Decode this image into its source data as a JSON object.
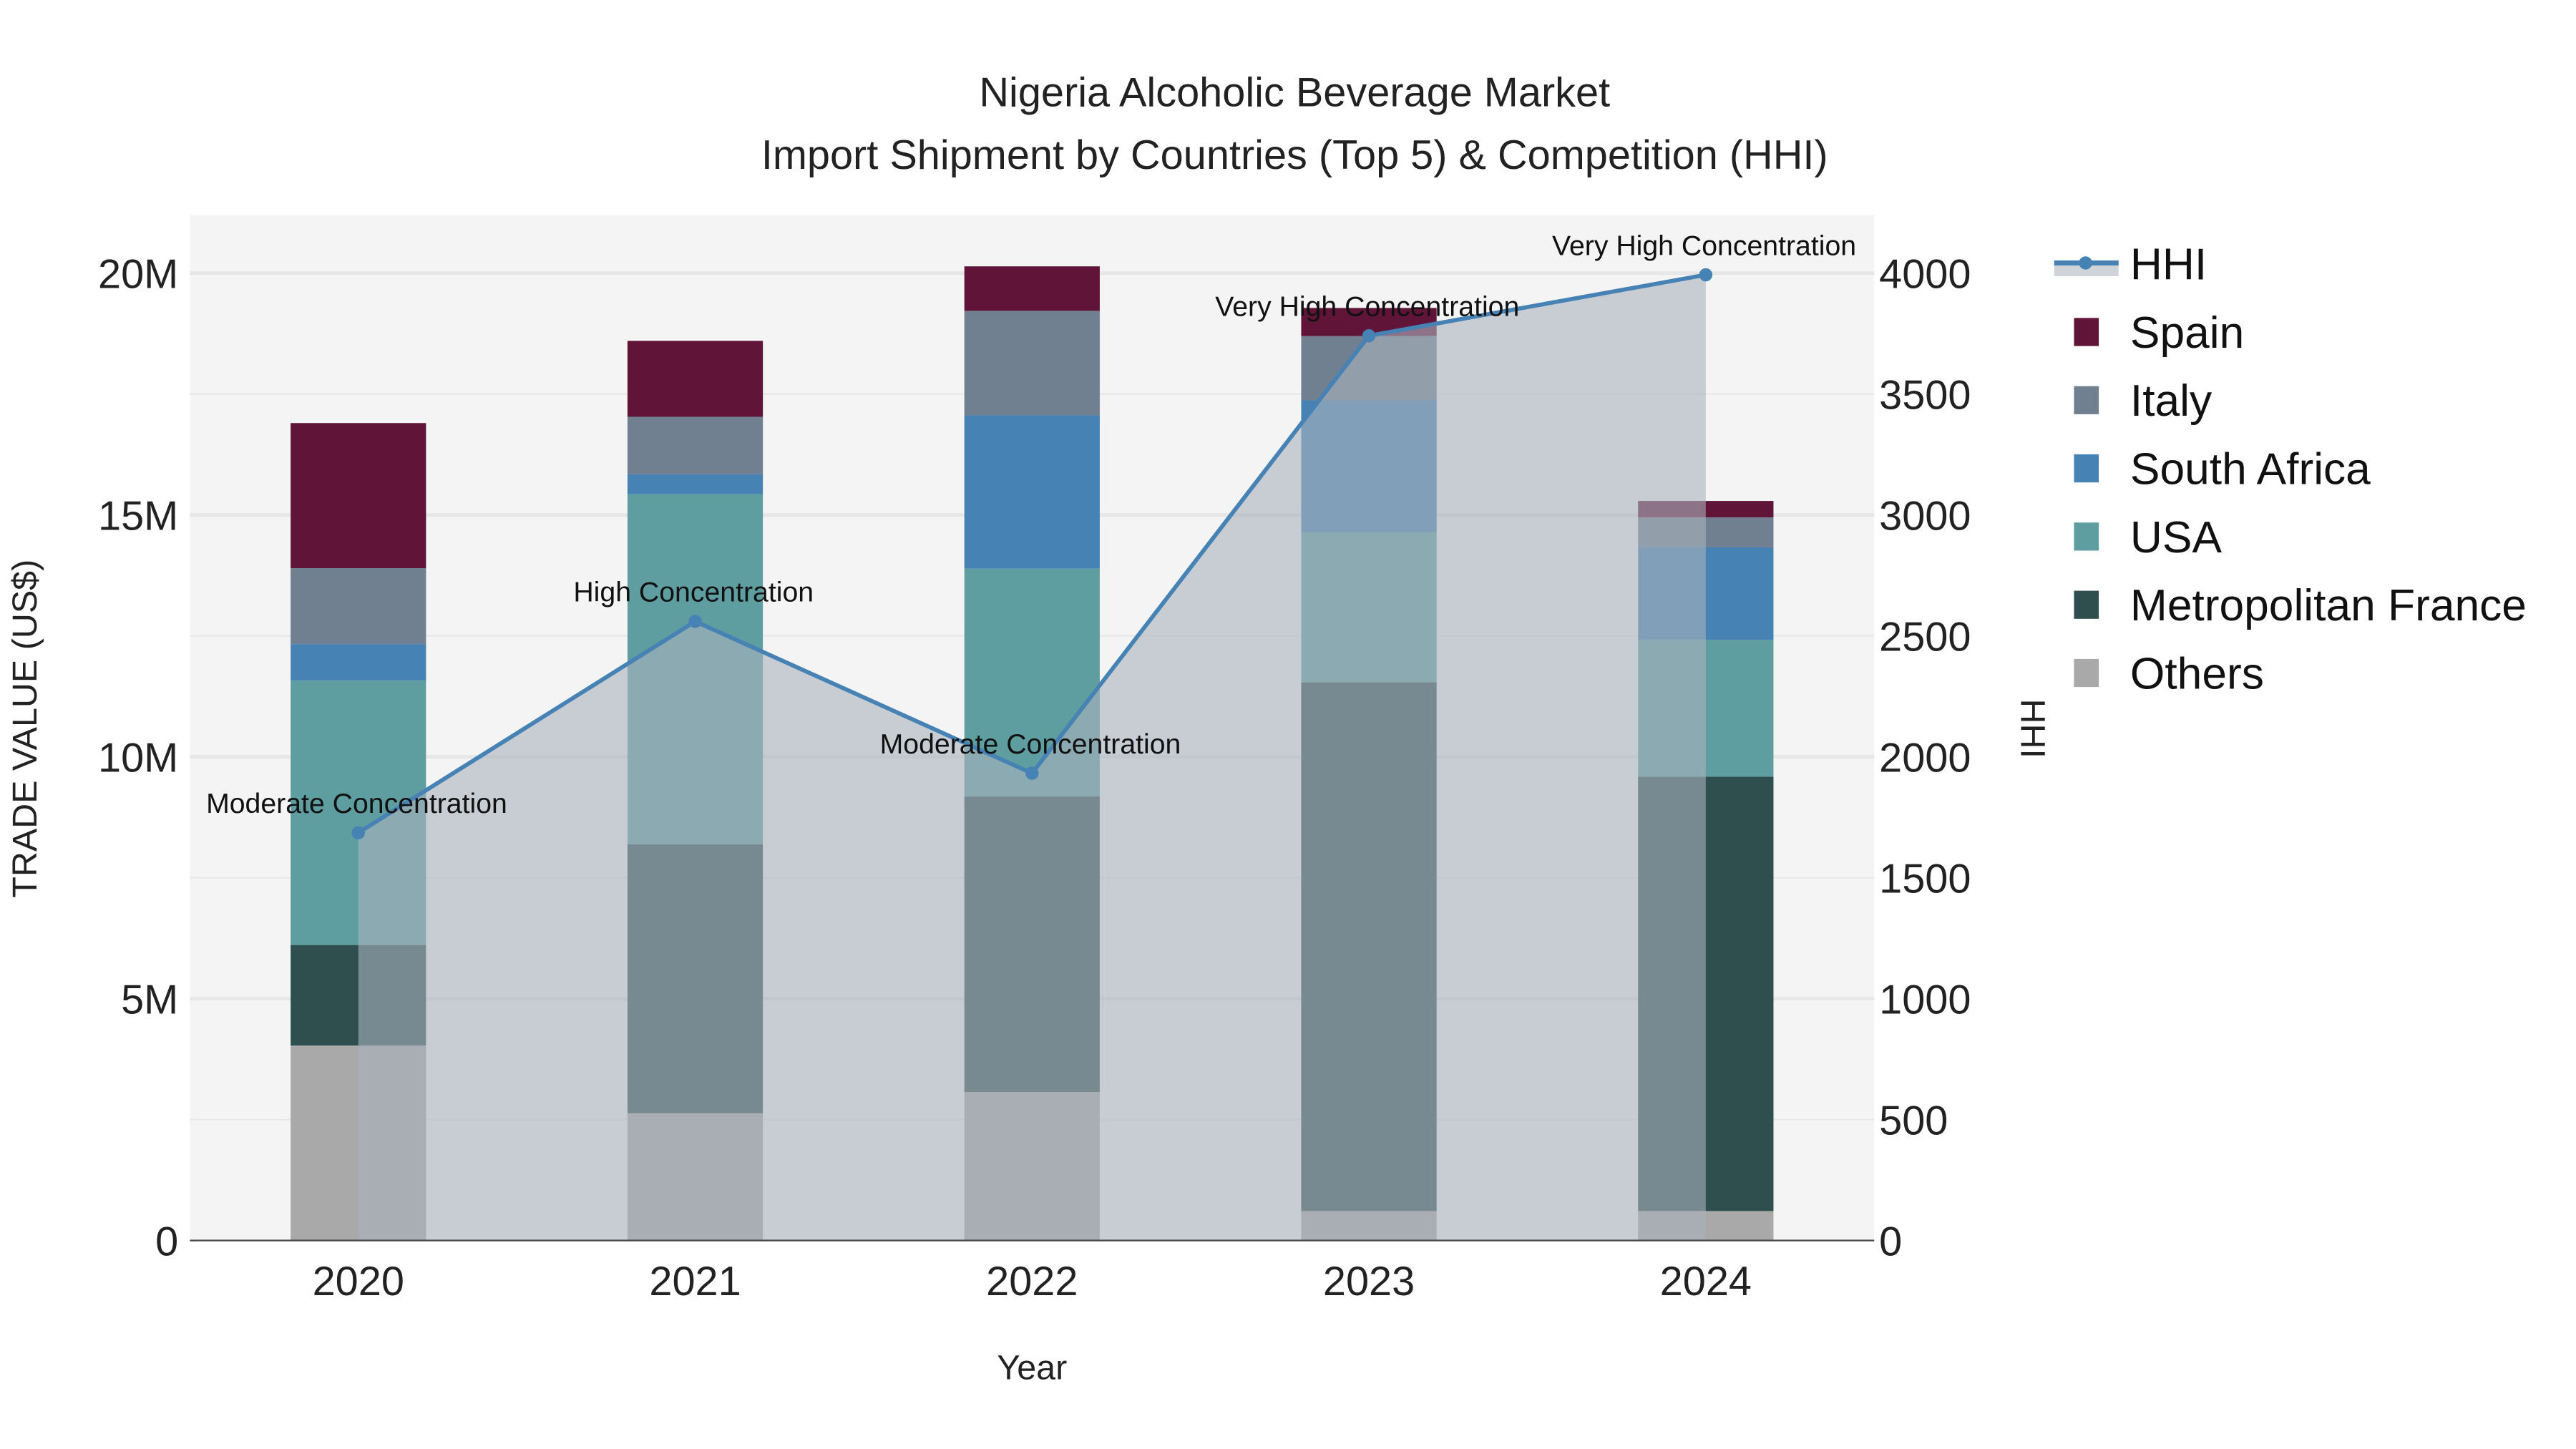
{
  "chart_data": {
    "type": "bar",
    "stacked": true,
    "title_line1": "Nigeria Alcoholic Beverage Market",
    "title_line2": "Import Shipment by Countries (Top 5) & Competition (HHI)",
    "xlabel": "Year",
    "ylabel": "TRADE VALUE (US$)",
    "y2label": "HHI",
    "categories": [
      "2020",
      "2021",
      "2022",
      "2023",
      "2024"
    ],
    "ylim": [
      0,
      21200000
    ],
    "y2lim": [
      0,
      4240
    ],
    "yticks": [
      {
        "v": 0,
        "label": "0"
      },
      {
        "v": 5000000,
        "label": "5M"
      },
      {
        "v": 10000000,
        "label": "10M"
      },
      {
        "v": 15000000,
        "label": "15M"
      },
      {
        "v": 20000000,
        "label": "20M"
      }
    ],
    "y2ticks": [
      {
        "v": 0,
        "label": "0"
      },
      {
        "v": 500,
        "label": "500"
      },
      {
        "v": 1000,
        "label": "1000"
      },
      {
        "v": 1500,
        "label": "1500"
      },
      {
        "v": 2000,
        "label": "2000"
      },
      {
        "v": 2500,
        "label": "2500"
      },
      {
        "v": 3000,
        "label": "3000"
      },
      {
        "v": 3500,
        "label": "3500"
      },
      {
        "v": 4000,
        "label": "4000"
      }
    ],
    "series": [
      {
        "name": "Others",
        "color": "#a9a9a9",
        "values": [
          4030000,
          2630000,
          3070000,
          610000,
          610000
        ]
      },
      {
        "name": "Metropolitan France",
        "color": "#2f4f4f",
        "values": [
          2080000,
          5560000,
          6110000,
          10930000,
          8980000
        ]
      },
      {
        "name": "USA",
        "color": "#5f9ea0",
        "values": [
          5470000,
          7240000,
          4710000,
          3100000,
          2830000
        ]
      },
      {
        "name": "South Africa",
        "color": "#4682b4",
        "values": [
          750000,
          410000,
          3170000,
          2730000,
          1910000
        ]
      },
      {
        "name": "Italy",
        "color": "#708090",
        "values": [
          1570000,
          1190000,
          2160000,
          1330000,
          620000
        ]
      },
      {
        "name": "Spain",
        "color": "#601437",
        "values": [
          3000000,
          1570000,
          920000,
          580000,
          340000
        ]
      }
    ],
    "hhi": {
      "name": "HHI",
      "color": "#4682b4",
      "fill": "rgba(170,178,190,0.6)",
      "values": [
        1686,
        2560,
        1932,
        3741,
        3993
      ],
      "annotations": [
        "Moderate Concentration",
        "High Concentration",
        "Moderate Concentration",
        "Very High Concentration",
        "Very High Concentration"
      ]
    },
    "legend_order": [
      "HHI",
      "Spain",
      "Italy",
      "South Africa",
      "USA",
      "Metropolitan France",
      "Others"
    ],
    "legend_position": "right",
    "grid": true
  }
}
